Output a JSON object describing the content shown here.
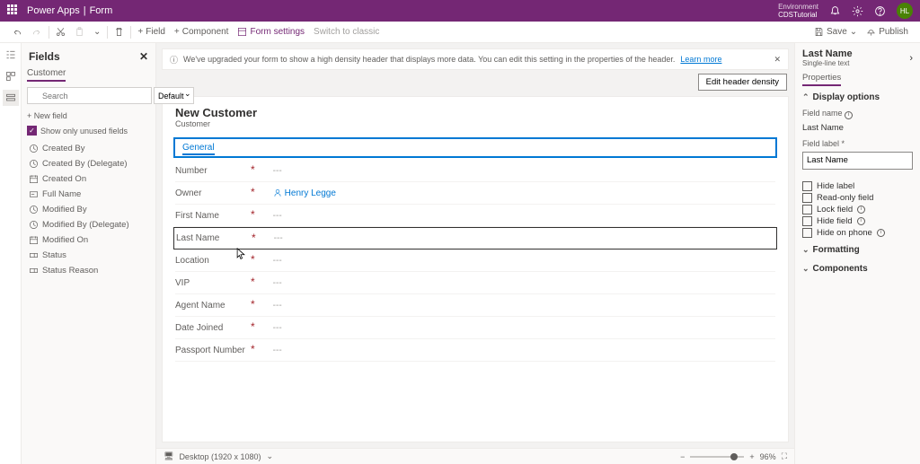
{
  "topbar": {
    "product": "Power Apps",
    "page": "Form",
    "env_label": "Environment",
    "env_name": "CDSTutorial",
    "avatar": "HL"
  },
  "cmdbar": {
    "field": "Field",
    "component": "Component",
    "formsettings": "Form settings",
    "switchclassic": "Switch to classic",
    "save": "Save",
    "publish": "Publish"
  },
  "fields": {
    "title": "Fields",
    "tab": "Customer",
    "search_ph": "Search",
    "default": "Default",
    "newfield": "New field",
    "showonly": "Show only unused fields",
    "items": [
      {
        "label": "Created By",
        "icon": "clock"
      },
      {
        "label": "Created By (Delegate)",
        "icon": "clock"
      },
      {
        "label": "Created On",
        "icon": "cal"
      },
      {
        "label": "Full Name",
        "icon": "text"
      },
      {
        "label": "Modified By",
        "icon": "clock"
      },
      {
        "label": "Modified By (Delegate)",
        "icon": "clock"
      },
      {
        "label": "Modified On",
        "icon": "cal"
      },
      {
        "label": "Status",
        "icon": "opt"
      },
      {
        "label": "Status Reason",
        "icon": "opt"
      }
    ]
  },
  "info": {
    "msg": "We've upgraded your form to show a high density header that displays more data. You can edit this setting in the properties of the header.",
    "learn": "Learn more",
    "edit_header": "Edit header density"
  },
  "form": {
    "title": "New Customer",
    "subtitle": "Customer",
    "tab": "General",
    "rows": [
      {
        "label": "Number",
        "value": "---",
        "req": true
      },
      {
        "label": "Owner",
        "value": "Henry Legge",
        "req": true,
        "owner": true
      },
      {
        "label": "First Name",
        "value": "---",
        "req": true
      },
      {
        "label": "Last Name",
        "value": "---",
        "req": true,
        "selected": true
      },
      {
        "label": "Location",
        "value": "---",
        "req": true
      },
      {
        "label": "VIP",
        "value": "---",
        "req": true
      },
      {
        "label": "Agent Name",
        "value": "---",
        "req": true
      },
      {
        "label": "Date Joined",
        "value": "---",
        "req": true
      },
      {
        "label": "Passport Number",
        "value": "---",
        "req": true
      }
    ]
  },
  "footer": {
    "device": "Desktop (1920 x 1080)",
    "zoom": "96%"
  },
  "props": {
    "title": "Last Name",
    "subtitle": "Single-line text",
    "tab": "Properties",
    "section1": "Display options",
    "fn_label": "Field name",
    "fn_value": "Last Name",
    "fl_label": "Field label *",
    "fl_value": "Last Name",
    "chk": [
      "Hide label",
      "Read-only field",
      "Lock field",
      "Hide field",
      "Hide on phone"
    ],
    "section2": "Formatting",
    "section3": "Components"
  }
}
